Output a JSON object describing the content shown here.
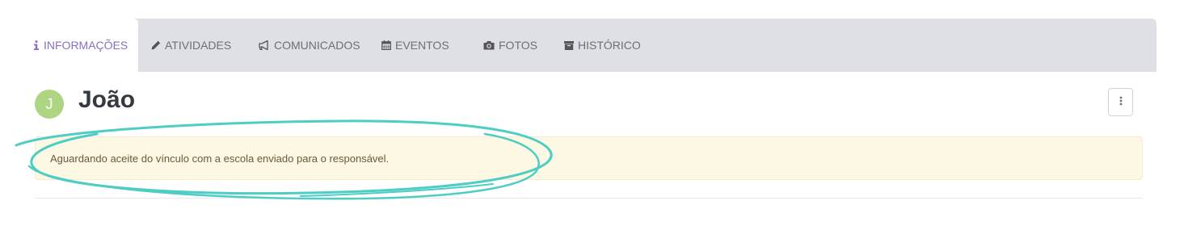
{
  "tabs": [
    {
      "label": "INFORMAÇÕES",
      "icon": "info-icon",
      "active": true
    },
    {
      "label": "ATIVIDADES",
      "icon": "pencil-icon",
      "active": false
    },
    {
      "label": "COMUNICADOS",
      "icon": "megaphone-icon",
      "active": false
    },
    {
      "label": "EVENTOS",
      "icon": "calendar-icon",
      "active": false
    },
    {
      "label": "FOTOS",
      "icon": "camera-icon",
      "active": false
    },
    {
      "label": "HISTÓRICO",
      "icon": "archive-icon",
      "active": false
    }
  ],
  "student": {
    "initial": "J",
    "name": "João",
    "avatar_color": "#aed581"
  },
  "alert": {
    "message": "Aguardando aceite do vínculo com a escola enviado para o responsável."
  },
  "colors": {
    "accent": "#8a6fc4",
    "annotation": "#4ecdc4",
    "alert_bg": "#fcf8e3"
  }
}
